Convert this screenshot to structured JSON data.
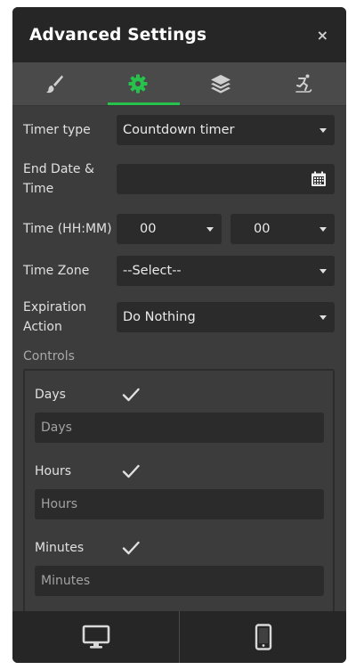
{
  "header": {
    "title": "Advanced Settings",
    "close": "×"
  },
  "tabs": [
    {
      "icon": "brush-icon",
      "active": false
    },
    {
      "icon": "gear-icon",
      "active": true
    },
    {
      "icon": "layers-icon",
      "active": false
    },
    {
      "icon": "skater-icon",
      "active": false
    }
  ],
  "accent_color": "#27c24c",
  "fields": {
    "timer_type": {
      "label": "Timer type",
      "value": "Countdown timer"
    },
    "end_date": {
      "label": "End Date & Time",
      "value": ""
    },
    "time": {
      "label": "Time (HH:MM)",
      "hours": "00",
      "minutes": "00"
    },
    "timezone": {
      "label": "Time Zone",
      "value": "--Select--"
    },
    "expiration": {
      "label": "Expiration Action",
      "value": "Do Nothing"
    }
  },
  "controls": {
    "title": "Controls",
    "items": [
      {
        "label": "Days",
        "checked": true,
        "placeholder": "Days"
      },
      {
        "label": "Hours",
        "checked": true,
        "placeholder": "Hours"
      },
      {
        "label": "Minutes",
        "checked": true,
        "placeholder": "Minutes"
      }
    ]
  },
  "footer": {
    "desktop_icon": "desktop-icon",
    "mobile_icon": "mobile-icon"
  }
}
